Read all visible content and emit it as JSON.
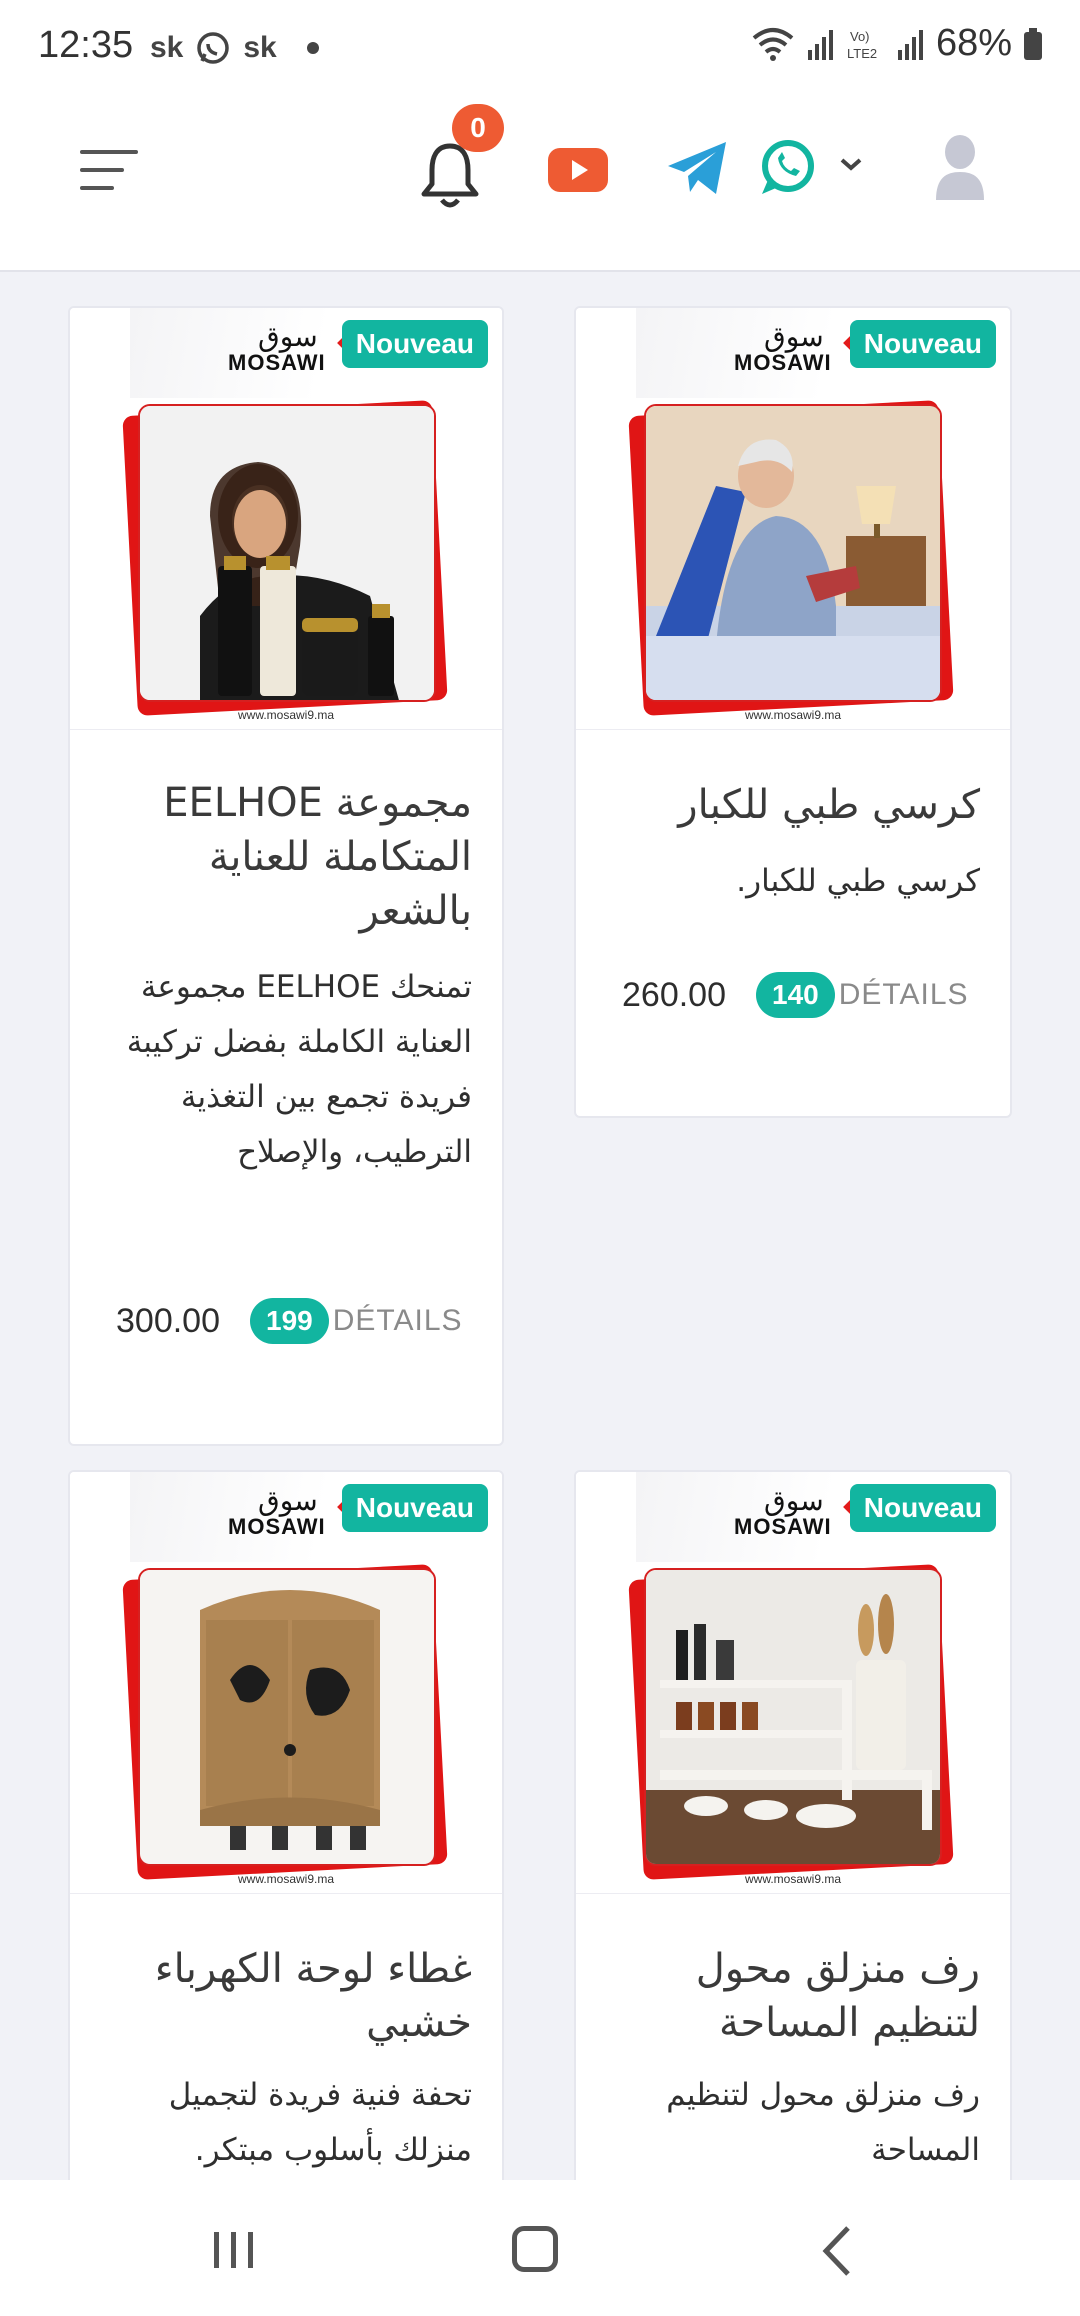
{
  "status_bar": {
    "time": "12:35",
    "notif_1": "sk",
    "notif_2": "sk",
    "battery": "68%"
  },
  "header": {
    "notification_count": "0",
    "icons": [
      "menu-icon",
      "bell-icon",
      "youtube-icon",
      "telegram-icon",
      "whatsapp-icon",
      "chevron-down-icon",
      "user-avatar-icon"
    ]
  },
  "colors": {
    "accent": "#12b5a0",
    "badge": "#ee5b33",
    "brand_red": "#e01515"
  },
  "products": [
    {
      "logo_ar": "سوق",
      "logo_en": "MOSAWI",
      "badge": "Nouveau",
      "url": "www.mosawi9.ma",
      "title": "مجموعة EELHOE المتكاملة للعناية بالشعر",
      "description": "تمنحك EELHOE مجموعة العناية الكاملة بفضل تركيبة فريدة تجمع بين التغذية الترطيب، والإصلاح",
      "price": "300.00",
      "count": "199",
      "details_label": "DÉTAILS"
    },
    {
      "logo_ar": "سوق",
      "logo_en": "MOSAWI",
      "badge": "Nouveau",
      "url": "www.mosawi9.ma",
      "title": "كرسي طبي للكبار",
      "description": "كرسي طبي للكبار.",
      "price": "260.00",
      "count": "140",
      "details_label": "DÉTAILS"
    },
    {
      "logo_ar": "سوق",
      "logo_en": "MOSAWI",
      "badge": "Nouveau",
      "url": "www.mosawi9.ma",
      "title": "غطاء لوحة الكهرباء خشبي",
      "description": "تحفة فنية فريدة لتجميل منزلك بأسلوب مبتكر.",
      "price": "",
      "count": "",
      "details_label": ""
    },
    {
      "logo_ar": "سوق",
      "logo_en": "MOSAWI",
      "badge": "Nouveau",
      "url": "www.mosawi9.ma",
      "title": "رف منزلق محول لتنظيم المساحة",
      "description": "رف منزلق محول لتنظيم المساحة",
      "price": "",
      "count": "",
      "details_label": ""
    }
  ],
  "nav_bar": {
    "icons": [
      "recent-apps-icon",
      "home-icon",
      "back-icon"
    ]
  }
}
